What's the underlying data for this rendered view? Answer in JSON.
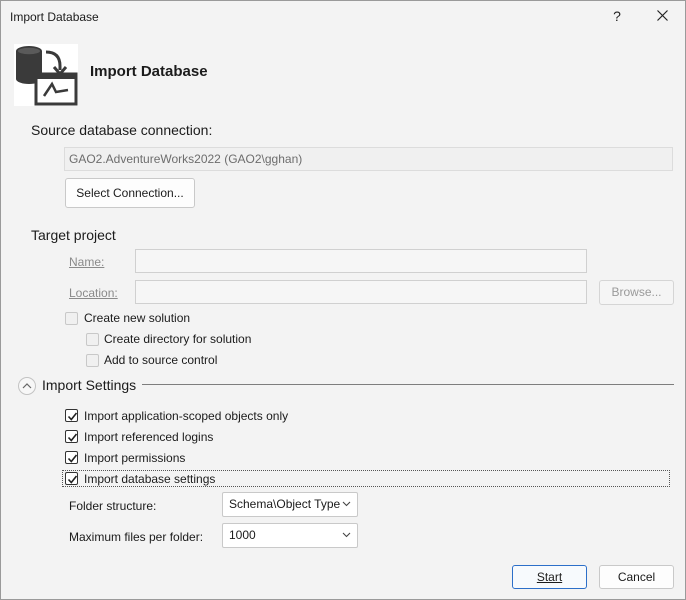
{
  "window": {
    "title": "Import Database",
    "help_label": "?",
    "header_title": "Import Database"
  },
  "source": {
    "section_label": "Source database connection:",
    "connection_value": "GAO2.AdventureWorks2022 (GAO2\\gghan)",
    "select_button": "Select Connection..."
  },
  "target": {
    "section_label": "Target project",
    "name_label": "Name:",
    "location_label": "Location:",
    "browse_button": "Browse...",
    "create_new_solution": "Create new solution",
    "create_directory": "Create directory for solution",
    "add_to_source_control": "Add to source control"
  },
  "import_settings": {
    "section_label": "Import Settings",
    "options": [
      {
        "label": "Import application-scoped objects only",
        "checked": true
      },
      {
        "label": "Import referenced logins",
        "checked": true
      },
      {
        "label": "Import permissions",
        "checked": true
      },
      {
        "label": "Import database settings",
        "checked": true
      }
    ],
    "folder_structure_label": "Folder structure:",
    "folder_structure_value": "Schema\\Object Type",
    "max_files_label": "Maximum files per folder:",
    "max_files_value": "1000"
  },
  "footer": {
    "start_button": "Start",
    "cancel_button": "Cancel"
  }
}
